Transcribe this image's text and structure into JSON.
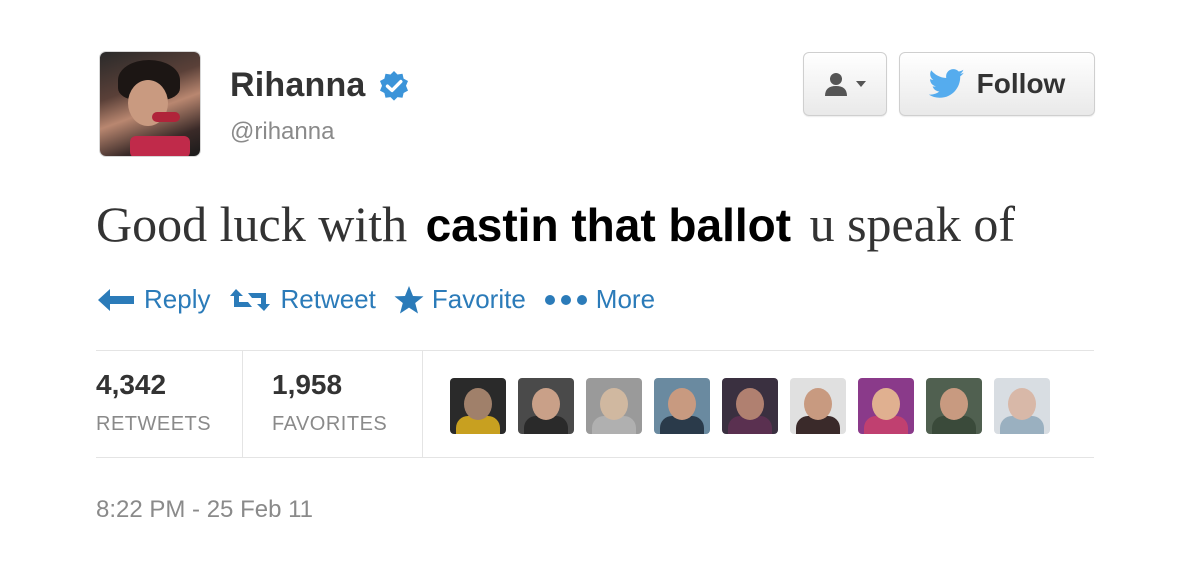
{
  "user": {
    "display_name": "Rihanna",
    "handle": "@rihanna",
    "verified": true,
    "avatar_icon": "profile-photo"
  },
  "header": {
    "user_menu_icon": "person-dropdown-icon",
    "follow_label": "Follow",
    "follow_icon": "twitter-bird-icon"
  },
  "tweet": {
    "text_before": "Good luck with",
    "overlay_text": "castin that ballot",
    "text_after": "u speak of"
  },
  "actions": [
    {
      "label": "Reply",
      "icon": "reply-arrow-icon"
    },
    {
      "label": "Retweet",
      "icon": "retweet-icon"
    },
    {
      "label": "Favorite",
      "icon": "star-icon"
    },
    {
      "label": "More",
      "icon": "more-dots-icon"
    }
  ],
  "stats": {
    "retweets_value": "4,342",
    "retweets_label": "RETWEETS",
    "favorites_value": "1,958",
    "favorites_label": "FAVORITES"
  },
  "favoriters": [
    {
      "bg": "#2a2a2a",
      "skin": "#a0806a",
      "shirt": "#c8a020"
    },
    {
      "bg": "#4a4a4a",
      "skin": "#c9a088",
      "shirt": "#2a2a2a"
    },
    {
      "bg": "#9a9a9a",
      "skin": "#d0b8a0",
      "shirt": "#b0b0b0"
    },
    {
      "bg": "#6a8aa0",
      "skin": "#c89a80",
      "shirt": "#2a3a4a"
    },
    {
      "bg": "#3a3040",
      "skin": "#b08070",
      "shirt": "#5a3050"
    },
    {
      "bg": "#e0e0e0",
      "skin": "#c89a80",
      "shirt": "#3a2a2a"
    },
    {
      "bg": "#8a3a8a",
      "skin": "#e0b090",
      "shirt": "#c04070"
    },
    {
      "bg": "#506050",
      "skin": "#c89a80",
      "shirt": "#3a4a3a"
    },
    {
      "bg": "#d8dde2",
      "skin": "#d8b8a8",
      "shirt": "#9ab0c0"
    }
  ],
  "timestamp": "8:22 PM - 25 Feb 11",
  "colors": {
    "link_blue": "#2b7bb9",
    "verified_blue": "#3b94d9",
    "twitter_blue": "#55acee",
    "text": "#333333",
    "muted": "#8a8a8a"
  }
}
